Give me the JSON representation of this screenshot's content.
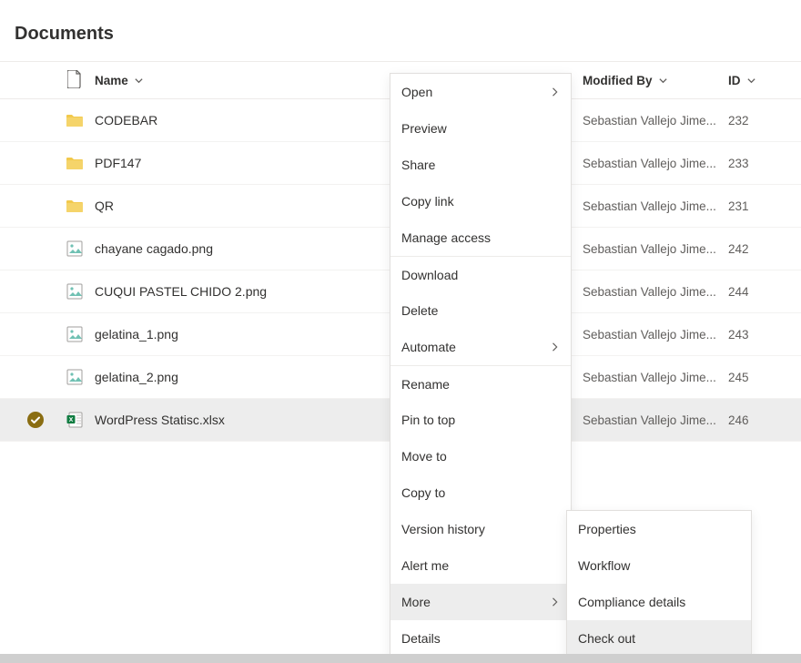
{
  "page": {
    "title": "Documents"
  },
  "columns": {
    "name": "Name",
    "modified_by": "Modified By",
    "id": "ID"
  },
  "rows": [
    {
      "type": "folder",
      "name": "CODEBAR",
      "modified_by": "Sebastian Vallejo Jime...",
      "id": "232",
      "selected": false
    },
    {
      "type": "folder",
      "name": "PDF147",
      "modified_by": "Sebastian Vallejo Jime...",
      "id": "233",
      "selected": false
    },
    {
      "type": "folder",
      "name": "QR",
      "modified_by": "Sebastian Vallejo Jime...",
      "id": "231",
      "selected": false
    },
    {
      "type": "image",
      "name": "chayane cagado.png",
      "modified_by": "Sebastian Vallejo Jime...",
      "id": "242",
      "selected": false
    },
    {
      "type": "image",
      "name": "CUQUI PASTEL CHIDO 2.png",
      "modified_by": "Sebastian Vallejo Jime...",
      "id": "244",
      "selected": false
    },
    {
      "type": "image",
      "name": "gelatina_1.png",
      "modified_by": "Sebastian Vallejo Jime...",
      "id": "243",
      "selected": false
    },
    {
      "type": "image",
      "name": "gelatina_2.png",
      "modified_by": "Sebastian Vallejo Jime...",
      "id": "245",
      "selected": false
    },
    {
      "type": "xlsx",
      "name": "WordPress Statisc.xlsx",
      "modified_by": "Sebastian Vallejo Jime...",
      "id": "246",
      "selected": true
    }
  ],
  "context_menu": {
    "items": [
      {
        "label": "Open",
        "submenu": true
      },
      {
        "label": "Preview"
      },
      {
        "label": "Share"
      },
      {
        "label": "Copy link"
      },
      {
        "label": "Manage access"
      },
      {
        "sep": true,
        "label": "Download"
      },
      {
        "label": "Delete"
      },
      {
        "label": "Automate",
        "submenu": true
      },
      {
        "sep": true,
        "label": "Rename"
      },
      {
        "label": "Pin to top"
      },
      {
        "label": "Move to"
      },
      {
        "label": "Copy to"
      },
      {
        "label": "Version history"
      },
      {
        "label": "Alert me"
      },
      {
        "label": "More",
        "submenu": true,
        "hover": true
      },
      {
        "label": "Details"
      }
    ],
    "more_submenu": [
      {
        "label": "Properties"
      },
      {
        "label": "Workflow"
      },
      {
        "label": "Compliance details"
      },
      {
        "label": "Check out",
        "hover": true
      }
    ]
  }
}
